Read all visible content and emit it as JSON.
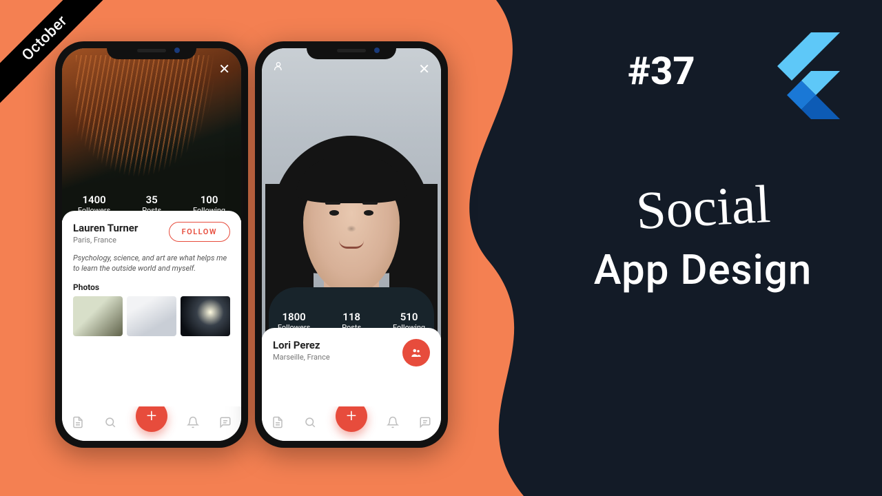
{
  "ribbon": "October",
  "episode": "#37",
  "title_script": "Social",
  "title_sub": "App Design",
  "phone1": {
    "close_icon": "✕",
    "stats": {
      "followers_count": "1400",
      "followers_label": "Followers",
      "posts_count": "35",
      "posts_label": "Posts",
      "following_count": "100",
      "following_label": "Following"
    },
    "name": "Lauren Turner",
    "location": "Paris, France",
    "follow_label": "FOLLOW",
    "bio": "Psychology, science, and art are what helps me to learn the outside world and myself.",
    "photos_label": "Photos"
  },
  "phone2": {
    "close_icon": "✕",
    "stats": {
      "followers_count": "1800",
      "followers_label": "Followers",
      "posts_count": "118",
      "posts_label": "Posts",
      "following_count": "510",
      "following_label": "Following"
    },
    "name": "Lori Perez",
    "location": "Marseille, France"
  },
  "nav": {
    "plus": "+"
  }
}
